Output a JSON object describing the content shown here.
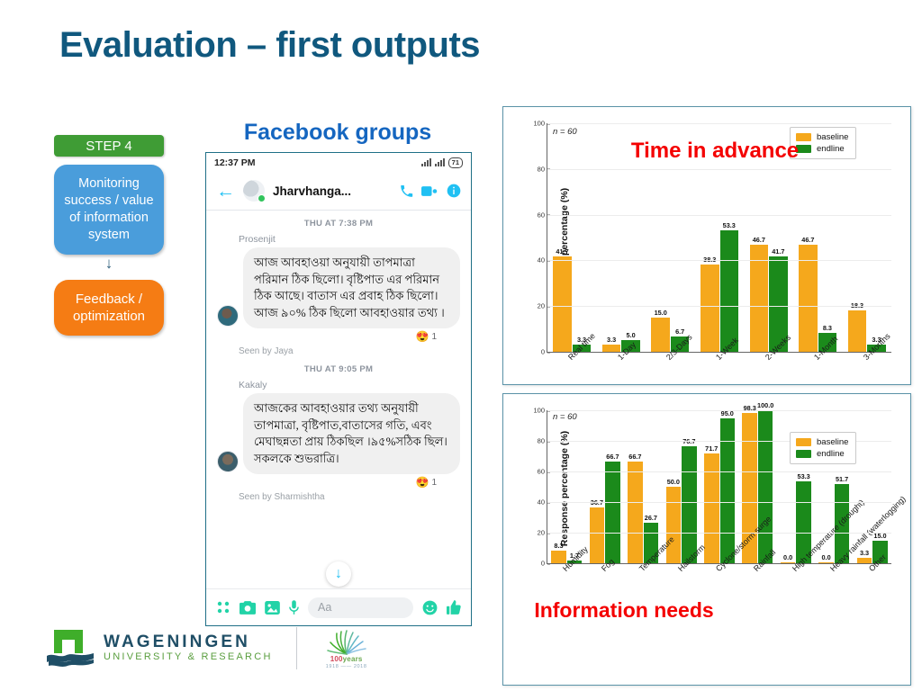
{
  "slide": {
    "title": "Evaluation – first outputs"
  },
  "flow": {
    "step_badge": "STEP 4",
    "box_blue": "Monitoring success / value of information system",
    "arrow_glyph": "↓",
    "box_orange": "Feedback / optimization"
  },
  "phone": {
    "heading": "Facebook groups",
    "status": {
      "time": "12:37 PM",
      "battery": "71"
    },
    "header": {
      "back_icon": "←",
      "contact_name": "Jharvhanga...",
      "call_icon": "phone-icon",
      "video_icon": "video-icon",
      "info_icon": "info-icon"
    },
    "messages": [
      {
        "daystamp": "THU AT 7:38 PM",
        "sender": "Prosenjit",
        "text": "আজ আবহাওয়া অনুযায়ী তাপমাত্রা পরিমান ঠিক ছিলো। বৃষ্টিপাত এর পরিমান ঠিক আছে। বাতাস এর প্রবাহ ঠিক ছিলো। আজ ৯০% ঠিক ছিলো আবহাওয়ার তথ্য ।",
        "reaction_icon": "😍",
        "reaction_count": "1",
        "seen_by": "Seen by Jaya"
      },
      {
        "daystamp": "THU AT 9:05 PM",
        "sender": "Kakaly",
        "text": "আজকের আবহাওয়ার তথ্য অনুযায়ী তাপমাত্রা, বৃষ্টিপাত,বাতাসের গতি, এবং মেঘাছন্নতা প্রায় ঠিকছিল ।৯৫%সঠিক ছিল। সকলকে শুভরাত্রি।",
        "reaction_icon": "😍",
        "reaction_count": "1",
        "seen_by": "Seen by Sharmishtha"
      }
    ],
    "composer": {
      "apps_icon": "apps-grid-icon",
      "camera_icon": "camera-icon",
      "gallery_icon": "gallery-icon",
      "mic_icon": "microphone-icon",
      "input_placeholder": "Aa",
      "emoji_icon": "emoji-icon",
      "like_icon": "thumbs-up-icon"
    },
    "scroll_down_icon": "↓"
  },
  "logos": {
    "wur_line1": "WAGENINGEN",
    "wur_line2": "UNIVERSITY & RESEARCH",
    "centenary_100": "100",
    "centenary_years": "years",
    "centenary_range": "1918 —— 2018"
  },
  "colors": {
    "baseline": "#F5A81C",
    "endline": "#1B8A1B",
    "title_blue": "#10587e",
    "red_heading": "#f40000",
    "chart_border": "#5b93a8"
  },
  "chart_data": [
    {
      "id": "time-in-advance",
      "type": "bar",
      "title": "Time in advance",
      "annotation": "n = 60",
      "xlabel": "",
      "ylabel": "Response percentage (%)",
      "ylim": [
        0,
        100
      ],
      "yticks": [
        0,
        20,
        40,
        60,
        80,
        100
      ],
      "grid": true,
      "legend_position": "upper right",
      "categories": [
        "Real time",
        "1-Day",
        "2/3-Days",
        "1-Week",
        "2-Weeks",
        "1-Month",
        "3-Months"
      ],
      "series": [
        {
          "name": "baseline",
          "color": "#F5A81C",
          "values": [
            41.7,
            3.3,
            15.0,
            38.3,
            46.7,
            46.7,
            18.3
          ]
        },
        {
          "name": "endline",
          "color": "#1B8A1B",
          "values": [
            3.3,
            5.0,
            6.7,
            53.3,
            41.7,
            8.3,
            3.3
          ]
        }
      ]
    },
    {
      "id": "information-needs",
      "type": "bar",
      "title": "Information needs",
      "annotation": "n = 60",
      "xlabel": "",
      "ylabel": "Response percentage (%)",
      "ylim": [
        0,
        100
      ],
      "yticks": [
        0,
        20,
        40,
        60,
        80,
        100
      ],
      "grid": true,
      "legend_position": "upper right",
      "categories": [
        "Humidity",
        "Fog",
        "Temperature",
        "Hailstorm",
        "Cyclone/storm surge",
        "Rainfall",
        "High temperature (drought)",
        "Heavy rainfall (waterlogging)",
        "Other"
      ],
      "series": [
        {
          "name": "baseline",
          "color": "#F5A81C",
          "values": [
            8.3,
            36.7,
            66.7,
            50.0,
            71.7,
            98.3,
            0.0,
            0.0,
            3.3
          ]
        },
        {
          "name": "endline",
          "color": "#1B8A1B",
          "values": [
            1.7,
            66.7,
            26.7,
            76.7,
            95.0,
            100.0,
            53.3,
            51.7,
            15.0
          ]
        }
      ]
    }
  ]
}
